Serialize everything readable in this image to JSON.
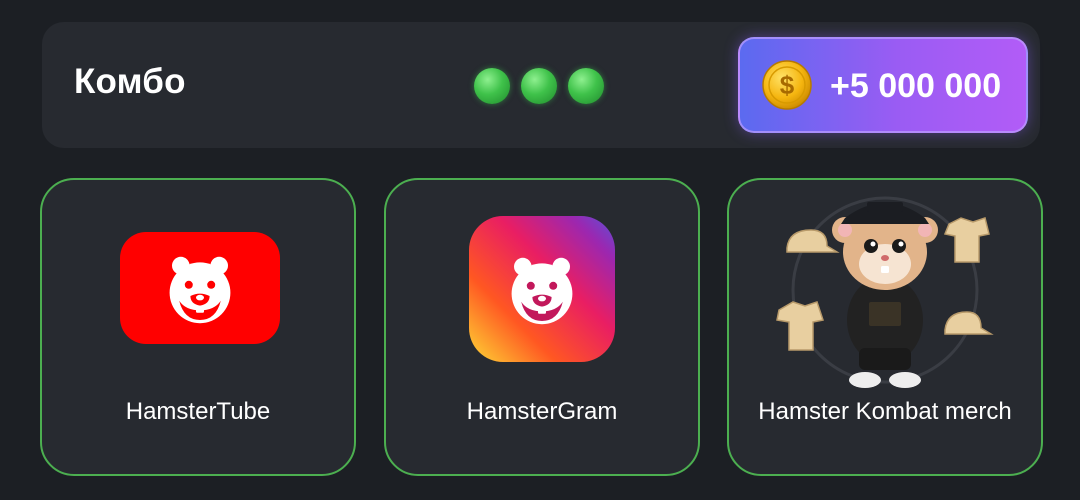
{
  "combo": {
    "title": "Комбо",
    "dots_found": 3,
    "dots_total": 3,
    "reward": "+5 000 000"
  },
  "cards": [
    {
      "label": "HamsterTube",
      "icon": "hamstertube-icon"
    },
    {
      "label": "HamsterGram",
      "icon": "hamstergram-icon"
    },
    {
      "label": "Hamster Kombat merch",
      "icon": "hamster-merch-icon"
    }
  ],
  "colors": {
    "background": "#1c1f24",
    "panel": "#272a30",
    "accent_green": "#4caf50",
    "reward_gradient_start": "#5b6af0",
    "reward_gradient_end": "#b25cf7",
    "coin": "#f5b50f",
    "tube_red": "#ff0000"
  }
}
